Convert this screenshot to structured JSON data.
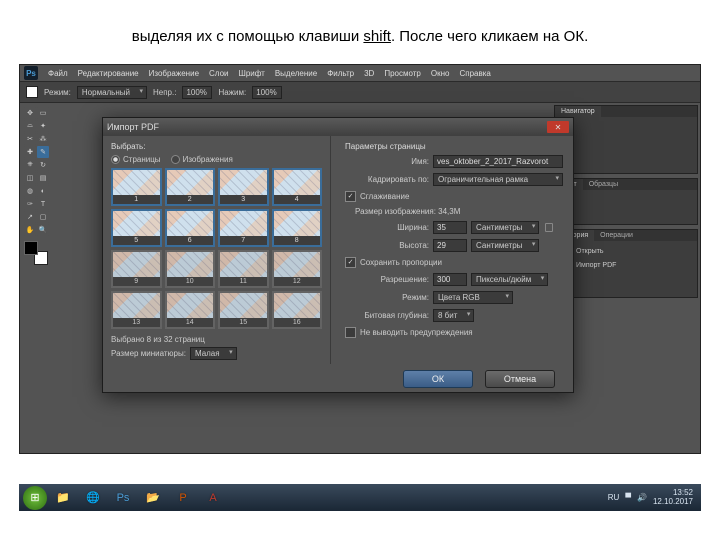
{
  "caption_parts": {
    "a": "выделяя их с помощью клавиши ",
    "b": "shift",
    "c": ". После чего кликаем на ОК."
  },
  "app": {
    "logo": "Ps"
  },
  "menu": [
    "Файл",
    "Редактирование",
    "Изображение",
    "Слои",
    "Шрифт",
    "Выделение",
    "Фильтр",
    "3D",
    "Просмотр",
    "Окно",
    "Справка"
  ],
  "optbar": {
    "mode_label": "Режим:",
    "mode_value": "Нормальный",
    "opacity_label": "Непр.:",
    "opacity_value": "100%",
    "flow_label": "Нажим:",
    "flow_value": "100%"
  },
  "panels": {
    "nav": "Навигатор",
    "color": "Цвет",
    "swatches": "Образцы",
    "history": "История",
    "actions": "Операции",
    "history_items": [
      "Открыть",
      "Импорт PDF"
    ]
  },
  "dialog": {
    "title": "Импорт PDF",
    "select_label": "Выбрать:",
    "radio_pages": "Страницы",
    "radio_images": "Изображения",
    "pages": [
      1,
      2,
      3,
      4,
      5,
      6,
      7,
      8,
      9,
      10,
      11,
      12,
      13,
      14,
      15,
      16
    ],
    "selected_info": "Выбрано 8 из 32 страниц",
    "thumb_size_label": "Размер миниатюры:",
    "thumb_size_value": "Малая",
    "params_title": "Параметры страницы",
    "name_label": "Имя:",
    "name_value": "ves_oktober_2_2017_Razvorot",
    "crop_label": "Кадрировать по:",
    "crop_value": "Ограничительная рамка",
    "antialias": "Сглаживание",
    "size_line": "Размер изображения: 34,3М",
    "width_label": "Ширина:",
    "width_value": "35",
    "width_unit": "Сантиметры",
    "height_label": "Высота:",
    "height_value": "29",
    "height_unit": "Сантиметры",
    "constrain": "Сохранить пропорции",
    "res_label": "Разрешение:",
    "res_value": "300",
    "res_unit": "Пикселы/дюйм",
    "mode_label": "Режим:",
    "mode_value": "Цвета RGB",
    "depth_label": "Битовая глубина:",
    "depth_value": "8 бит",
    "suppress": "Не выводить предупреждения",
    "ok": "ОК",
    "cancel": "Отмена"
  },
  "taskbar": {
    "lang": "RU",
    "time": "13:52",
    "date": "12.10.2017"
  }
}
